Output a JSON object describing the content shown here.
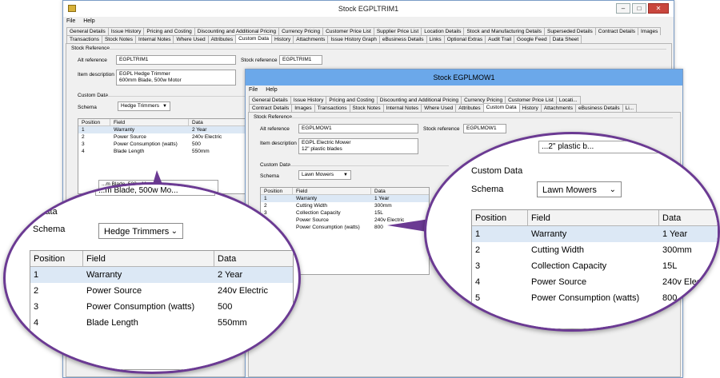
{
  "window1": {
    "title": "Stock EGPLTRIM1",
    "menu": [
      "File",
      "Help"
    ],
    "tabs_row1": [
      "General Details",
      "Issue History",
      "Pricing and Costing",
      "Discounting and Additional Pricing",
      "Currency Pricing",
      "Customer Price List",
      "Supplier Price List",
      "Location Details",
      "Stock and Manufacturing Details",
      "Superseded Details",
      "Contract Details",
      "Images"
    ],
    "tabs_row2": [
      "Transactions",
      "Stock Notes",
      "Internal Notes",
      "Where Used",
      "Attributes",
      "Custom Data",
      "History",
      "Attachments",
      "Issue History Graph",
      "eBusiness Details",
      "Links",
      "Optional Extras",
      "Audit Trail",
      "Google Feed",
      "Data Sheet"
    ],
    "active_tab": "Custom Data",
    "stock_reference_group": "Stock Reference",
    "alt_reference_label": "Alt reference",
    "alt_reference_value": "EGPLTRIM1",
    "stock_reference_label": "Stock reference",
    "stock_reference_value": "EGPLTRIM1",
    "item_description_label": "Item description",
    "item_description_value": "EGPL Hedge Trimmer\n600mm Blade, 500w Motor",
    "custom_data_group": "Custom Data",
    "schema_label": "Schema",
    "schema_value": "Hedge Trimmers",
    "grid_headers": [
      "Position",
      "Field",
      "Data"
    ],
    "rows": [
      {
        "position": "1",
        "field": "Warranty",
        "data": "2 Year"
      },
      {
        "position": "2",
        "field": "Power Source",
        "data": "240v Electric"
      },
      {
        "position": "3",
        "field": "Power Consumption (watts)",
        "data": "500"
      },
      {
        "position": "4",
        "field": "Blade Length",
        "data": "550mm"
      }
    ],
    "selected_row": 0,
    "edit_preview": "...m Blade, 500w Mo..."
  },
  "window2": {
    "title": "Stock EGPLMOW1",
    "menu": [
      "File",
      "Help"
    ],
    "tabs_row1": [
      "General Details",
      "Issue History",
      "Pricing and Costing",
      "Discounting and Additional Pricing",
      "Currency Pricing",
      "Customer Price List",
      "Locati..."
    ],
    "tabs_row2": [
      "Contract Details",
      "Images",
      "Transactions",
      "Stock Notes",
      "Internal Notes",
      "Where Used",
      "Attributes",
      "Custom Data",
      "History",
      "Attachments",
      "eBusiness Details",
      "Li..."
    ],
    "active_tab": "Custom Data",
    "stock_reference_group": "Stock Reference",
    "alt_reference_label": "Alt reference",
    "alt_reference_value": "EGPLMOW1",
    "stock_reference_label": "Stock reference",
    "stock_reference_value": "EGPLMOW1",
    "item_description_label": "Item description",
    "item_description_value": "EGPL Electric Mower\n12\" plastic blades",
    "custom_data_group": "Custom Data",
    "schema_label": "Schema",
    "schema_value": "Lawn Mowers",
    "grid_headers": [
      "Position",
      "Field",
      "Data"
    ],
    "rows": [
      {
        "position": "1",
        "field": "Warranty",
        "data": "1 Year"
      },
      {
        "position": "2",
        "field": "Cutting Width",
        "data": "300mm"
      },
      {
        "position": "3",
        "field": "Collection Capacity",
        "data": "15L"
      },
      {
        "position": "4",
        "field": "Power Source",
        "data": "240v Electric"
      },
      {
        "position": "5",
        "field": "Power Consumption (watts)",
        "data": "800"
      }
    ],
    "selected_row": 0
  },
  "zoom_left": {
    "group_label": "...m Data",
    "schema_label": "Schema",
    "schema_value": "Hedge Trimmers",
    "headers": [
      "Position",
      "Field",
      "Data"
    ],
    "top_fragment": "...m Blade, 500w Mo..."
  },
  "zoom_right": {
    "group_label": "Custom Data",
    "schema_label": "Schema",
    "schema_value": "Lawn Mowers",
    "headers": [
      "Position",
      "Field",
      "Data"
    ],
    "top_fragment": "...2\" plastic b..."
  },
  "accent_purple": "#6b3a93",
  "titlebar_blue": "#6ba8ea"
}
